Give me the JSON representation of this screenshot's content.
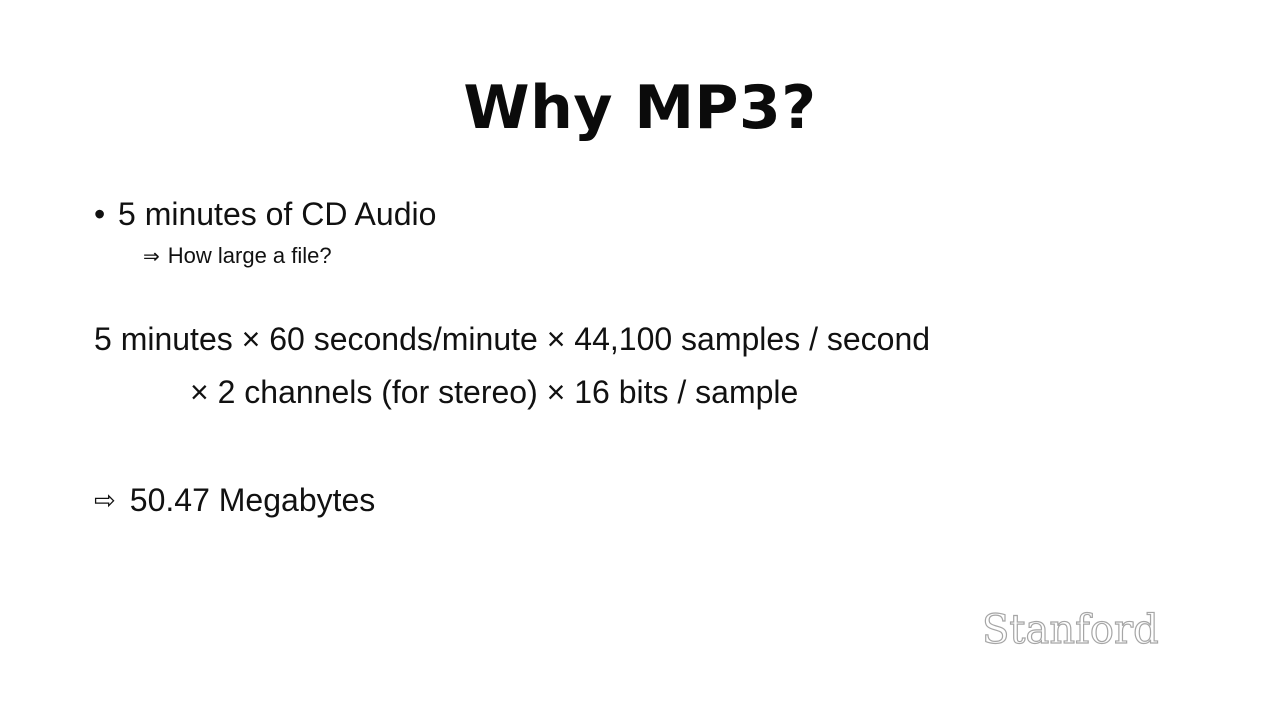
{
  "slide": {
    "title": "Why MP3?",
    "bullet": {
      "marker": "•",
      "text": "5 minutes of CD Audio"
    },
    "sub_bullet": {
      "marker": "⇒",
      "text": "How large a file?"
    },
    "calculation": {
      "line1": "5 minutes × 60 seconds/minute × 44,100 samples / second",
      "line2": "× 2 channels (for stereo) × 16 bits / sample"
    },
    "result": {
      "marker": "⇨",
      "text": "50.47 Megabytes"
    },
    "logo_text": "Stanford"
  }
}
